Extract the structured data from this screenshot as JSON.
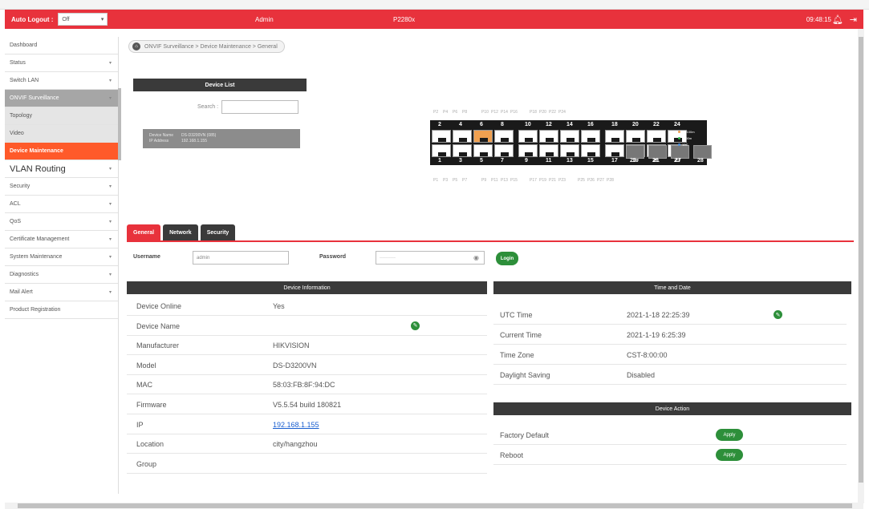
{
  "topbar": {
    "auto_logout_label": "Auto Logout :",
    "auto_logout_value": "Off",
    "user": "Admin",
    "model": "P2280x",
    "clock": "09:48:15"
  },
  "sidebar": {
    "items": [
      {
        "label": "Dashboard",
        "chevron": false
      },
      {
        "label": "Status",
        "chevron": true
      },
      {
        "label": "Switch LAN",
        "chevron": true
      },
      {
        "label": "ONVIF Surveillance",
        "chevron": true
      },
      {
        "label": "Topology",
        "chevron": false
      },
      {
        "label": "Video",
        "chevron": false
      },
      {
        "label": "Device Maintenance",
        "chevron": false
      },
      {
        "label": "VLAN Routing",
        "chevron": true
      },
      {
        "label": "Security",
        "chevron": true
      },
      {
        "label": "ACL",
        "chevron": true
      },
      {
        "label": "QoS",
        "chevron": true
      },
      {
        "label": "Certificate Management",
        "chevron": true
      },
      {
        "label": "System Maintenance",
        "chevron": true
      },
      {
        "label": "Diagnostics",
        "chevron": true
      },
      {
        "label": "Mail Alert",
        "chevron": true
      },
      {
        "label": "Product Registration",
        "chevron": false
      }
    ]
  },
  "breadcrumb": "ONVIF Surveillance > Device Maintenance > General",
  "device_list": {
    "title": "Device List",
    "search_label": "Search :",
    "entry": {
      "name_key": "Device Name",
      "name_val": "DS-D3200VN (085)",
      "ip_key": "IP Address",
      "ip_val": "192.168.1.155"
    }
  },
  "switch_panel": {
    "top_labels": [
      "P2",
      "P4",
      "P6",
      "P8",
      "P10",
      "P12",
      "P14",
      "P16",
      "P18",
      "P20",
      "P22",
      "P24"
    ],
    "bottom_labels": [
      "P1",
      "P3",
      "P5",
      "P7",
      "P9",
      "P11",
      "P13",
      "P15",
      "P17",
      "P19",
      "P21",
      "P23",
      "P25",
      "P26",
      "P27",
      "P28"
    ],
    "top_numbers": [
      "2",
      "4",
      "6",
      "8",
      "10",
      "12",
      "14",
      "16",
      "18",
      "20",
      "22",
      "24"
    ],
    "bottom_numbers": [
      "1",
      "3",
      "5",
      "7",
      "9",
      "11",
      "13",
      "15",
      "17",
      "19",
      "21",
      "23"
    ],
    "sfp_numbers": [
      "25",
      "26",
      "27",
      "28"
    ],
    "legend": [
      "10/100m",
      "1000m",
      "10G"
    ]
  },
  "tabs": [
    "General",
    "Network",
    "Security"
  ],
  "login": {
    "username_label": "Username",
    "username_value": "admin",
    "password_label": "Password",
    "password_value": "··········",
    "login_button": "Login"
  },
  "device_info": {
    "title": "Device Information",
    "rows": [
      {
        "k": "Device Online",
        "v": "Yes"
      },
      {
        "k": "Device Name",
        "v": ""
      },
      {
        "k": "Manufacturer",
        "v": "HIKVISION"
      },
      {
        "k": "Model",
        "v": "DS-D3200VN"
      },
      {
        "k": "MAC",
        "v": "58:03:FB:8F:94:DC"
      },
      {
        "k": "Firmware",
        "v": "V5.5.54 build 180821"
      },
      {
        "k": "IP",
        "v": "192.168.1.155"
      },
      {
        "k": "Location",
        "v": "city/hangzhou"
      },
      {
        "k": "Group",
        "v": ""
      }
    ]
  },
  "time_date": {
    "title": "Time and Date",
    "rows": [
      {
        "k": "UTC Time",
        "v": "2021-1-18 22:25:39"
      },
      {
        "k": "Current Time",
        "v": "2021-1-19 6:25:39"
      },
      {
        "k": "Time Zone",
        "v": "CST-8:00:00"
      },
      {
        "k": "Daylight Saving",
        "v": "Disabled"
      }
    ]
  },
  "device_action": {
    "title": "Device Action",
    "rows": [
      {
        "k": "Factory Default",
        "btn": "Apply"
      },
      {
        "k": "Reboot",
        "btn": "Apply"
      }
    ]
  },
  "colors": {
    "accent": "#e8323c",
    "active_sub": "#ff5a2a",
    "green": "#2d8f3a",
    "link": "#1a5fd0"
  }
}
